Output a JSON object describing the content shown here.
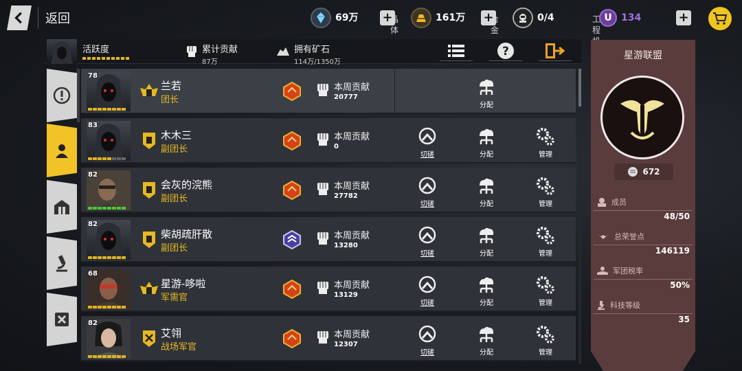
{
  "topbar": {
    "back_label": "返回",
    "resources": [
      {
        "name": "晶体",
        "value": "69万",
        "icon": "crystal-icon"
      },
      {
        "name": "合金",
        "value": "161万",
        "icon": "alloy-icon"
      },
      {
        "name": "工程机器人",
        "value": "0/4",
        "icon": "robot-icon"
      }
    ],
    "premium": {
      "symbol": "U",
      "value": "134",
      "color": "#8a5cc8"
    }
  },
  "subheader": {
    "activity_label": "活跃度",
    "total_contrib_label": "累计贡献",
    "total_contrib_value": "87万",
    "ore_label": "拥有矿石",
    "ore_value": "114万/1350万"
  },
  "members": [
    {
      "level": "78",
      "name": "兰若",
      "role": "团长",
      "contrib_label": "本周贡献",
      "contrib": "20777",
      "badge": "gold",
      "pips": "yellow",
      "actions": [
        {
          "label": "分配",
          "icon": "allocate-icon"
        }
      ]
    },
    {
      "level": "83",
      "name": "木木三",
      "role": "副团长",
      "contrib_label": "本周贡献",
      "contrib": "0",
      "badge": "gold",
      "pips": "yellow",
      "actions": [
        {
          "label": "切磋",
          "icon": "duel-icon"
        },
        {
          "label": "分配",
          "icon": "allocate-icon"
        },
        {
          "label": "管理",
          "icon": "manage-icon"
        }
      ]
    },
    {
      "level": "82",
      "name": "会灰的浣熊",
      "role": "副团长",
      "contrib_label": "本周贡献",
      "contrib": "27782",
      "badge": "gold",
      "pips": "green",
      "actions": [
        {
          "label": "切磋",
          "icon": "duel-icon"
        },
        {
          "label": "分配",
          "icon": "allocate-icon"
        },
        {
          "label": "管理",
          "icon": "manage-icon"
        }
      ]
    },
    {
      "level": "82",
      "name": "柴胡疏肝散",
      "role": "副团长",
      "contrib_label": "本周贡献",
      "contrib": "13280",
      "badge": "purple",
      "pips": "yellow",
      "actions": [
        {
          "label": "切磋",
          "icon": "duel-icon"
        },
        {
          "label": "分配",
          "icon": "allocate-icon"
        },
        {
          "label": "管理",
          "icon": "manage-icon"
        }
      ]
    },
    {
      "level": "68",
      "name": "星游-哆啦",
      "role": "军需官",
      "contrib_label": "本周贡献",
      "contrib": "13129",
      "badge": "gold",
      "pips": "yellow",
      "actions": [
        {
          "label": "切磋",
          "icon": "duel-icon"
        },
        {
          "label": "分配",
          "icon": "allocate-icon"
        },
        {
          "label": "管理",
          "icon": "manage-icon"
        }
      ]
    },
    {
      "level": "82",
      "name": "艾翎",
      "role": "战场军官",
      "contrib_label": "本周贡献",
      "contrib": "12307",
      "badge": "gold",
      "pips": "yellow",
      "actions": [
        {
          "label": "切磋",
          "icon": "duel-icon"
        },
        {
          "label": "分配",
          "icon": "allocate-icon"
        },
        {
          "label": "管理",
          "icon": "manage-icon"
        }
      ]
    }
  ],
  "alliance": {
    "name": "星游联盟",
    "score": "672",
    "stats": [
      {
        "label": "成员",
        "value": "48/50",
        "icon": "member-icon"
      },
      {
        "label": "总荣誉点",
        "value": "146119",
        "icon": "wings-icon"
      },
      {
        "label": "军团税率",
        "value": "50%",
        "icon": "tax-icon"
      },
      {
        "label": "科技等级",
        "value": "35",
        "icon": "microscope-icon"
      }
    ]
  },
  "colors": {
    "accent": "#f2c328",
    "alliance_bg": "#5b3c3c",
    "role": "#e6b822"
  }
}
